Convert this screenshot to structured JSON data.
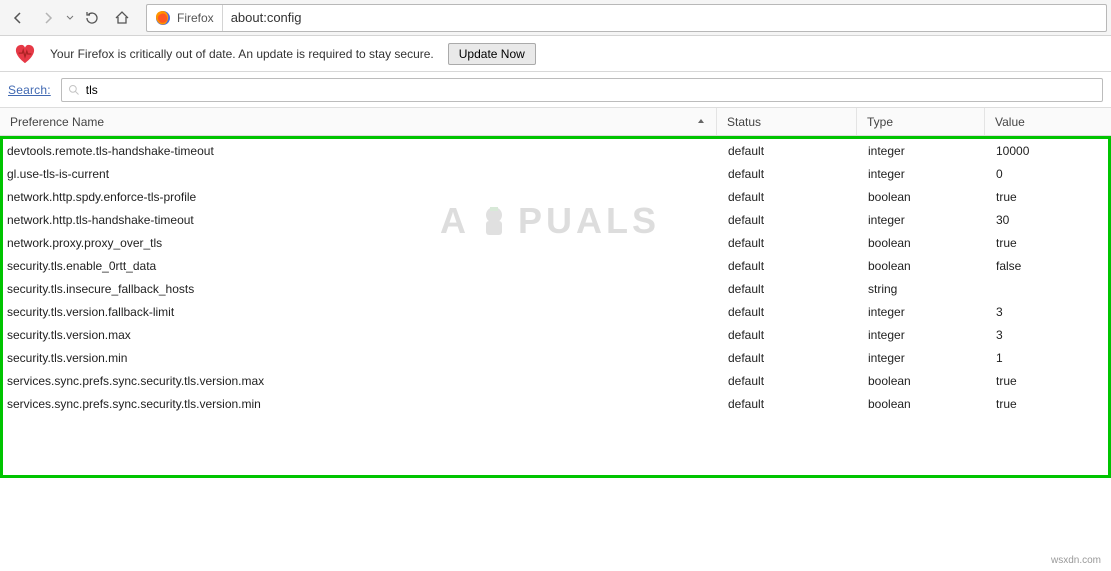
{
  "toolbar": {
    "identity": "Firefox",
    "url": "about:config"
  },
  "warning": {
    "text": "Your Firefox is critically out of date. An update is required to stay secure.",
    "button": "Update Now"
  },
  "search": {
    "label": "Search:",
    "value": "tls"
  },
  "columns": {
    "name": "Preference Name",
    "status": "Status",
    "type": "Type",
    "value": "Value"
  },
  "rows": [
    {
      "name": "devtools.remote.tls-handshake-timeout",
      "status": "default",
      "type": "integer",
      "value": "10000"
    },
    {
      "name": "gl.use-tls-is-current",
      "status": "default",
      "type": "integer",
      "value": "0"
    },
    {
      "name": "network.http.spdy.enforce-tls-profile",
      "status": "default",
      "type": "boolean",
      "value": "true"
    },
    {
      "name": "network.http.tls-handshake-timeout",
      "status": "default",
      "type": "integer",
      "value": "30"
    },
    {
      "name": "network.proxy.proxy_over_tls",
      "status": "default",
      "type": "boolean",
      "value": "true"
    },
    {
      "name": "security.tls.enable_0rtt_data",
      "status": "default",
      "type": "boolean",
      "value": "false"
    },
    {
      "name": "security.tls.insecure_fallback_hosts",
      "status": "default",
      "type": "string",
      "value": ""
    },
    {
      "name": "security.tls.version.fallback-limit",
      "status": "default",
      "type": "integer",
      "value": "3"
    },
    {
      "name": "security.tls.version.max",
      "status": "default",
      "type": "integer",
      "value": "3"
    },
    {
      "name": "security.tls.version.min",
      "status": "default",
      "type": "integer",
      "value": "1"
    },
    {
      "name": "services.sync.prefs.sync.security.tls.version.max",
      "status": "default",
      "type": "boolean",
      "value": "true"
    },
    {
      "name": "services.sync.prefs.sync.security.tls.version.min",
      "status": "default",
      "type": "boolean",
      "value": "true"
    }
  ],
  "watermark": "A  PUALS",
  "credit": "wsxdn.com"
}
